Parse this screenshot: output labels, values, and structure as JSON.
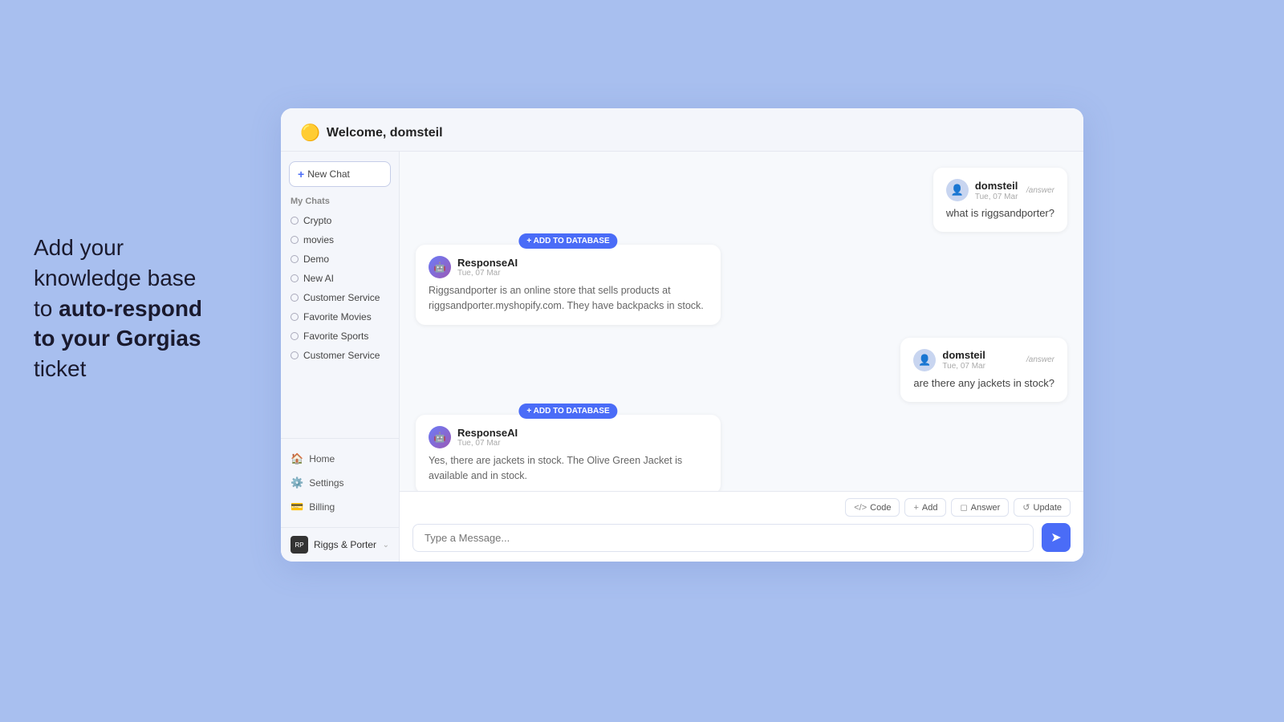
{
  "left_text": {
    "line1": "Add your",
    "line2": "knowledge base",
    "line3_normal": "to ",
    "line3_bold": "auto-respond",
    "line4_bold": "to your Gorgias",
    "line5": "ticket"
  },
  "header": {
    "icon": "🟡",
    "welcome": "Welcome, domsteil"
  },
  "sidebar": {
    "new_chat_label": "New Chat",
    "my_chats_label": "My Chats",
    "chats": [
      {
        "label": "Crypto"
      },
      {
        "label": "movies"
      },
      {
        "label": "Demo"
      },
      {
        "label": "New AI"
      },
      {
        "label": "Customer Service"
      },
      {
        "label": "Favorite Movies"
      },
      {
        "label": "Favorite Sports"
      },
      {
        "label": "Customer Service"
      }
    ],
    "nav": [
      {
        "icon": "🏠",
        "label": "Home"
      },
      {
        "icon": "⚙️",
        "label": "Settings"
      },
      {
        "icon": "💳",
        "label": "Billing"
      }
    ],
    "footer": {
      "logo_text": "RP",
      "name": "Riggs & Porter"
    }
  },
  "messages": [
    {
      "type": "user",
      "avatar": "👤",
      "name": "domsteil",
      "time": "Tue, 07 Mar",
      "badge": "/answer",
      "text": "what is riggsandporter?"
    },
    {
      "type": "ai",
      "name": "ResponseAI",
      "time": "Tue, 07 Mar",
      "add_to_db_label": "+ ADD TO DATABASE",
      "text": "Riggsandporter is an online store that sells products at riggsandporter.myshopify.com. They have backpacks in stock."
    },
    {
      "type": "user",
      "avatar": "👤",
      "name": "domsteil",
      "time": "Tue, 07 Mar",
      "badge": "/answer",
      "text": "are there any jackets in stock?"
    },
    {
      "type": "ai",
      "name": "ResponseAI",
      "time": "Tue, 07 Mar",
      "add_to_db_label": "+ ADD TO DATABASE",
      "text": "Yes, there are jackets in stock. The Olive Green Jacket is available and in stock."
    }
  ],
  "toolbar": {
    "buttons": [
      {
        "icon": "◻",
        "label": "Code"
      },
      {
        "icon": "+",
        "label": "Add"
      },
      {
        "icon": "◻",
        "label": "Answer"
      },
      {
        "icon": "◻",
        "label": "Update"
      }
    ]
  },
  "input": {
    "placeholder": "Type a Message...",
    "send_icon": "➤"
  }
}
